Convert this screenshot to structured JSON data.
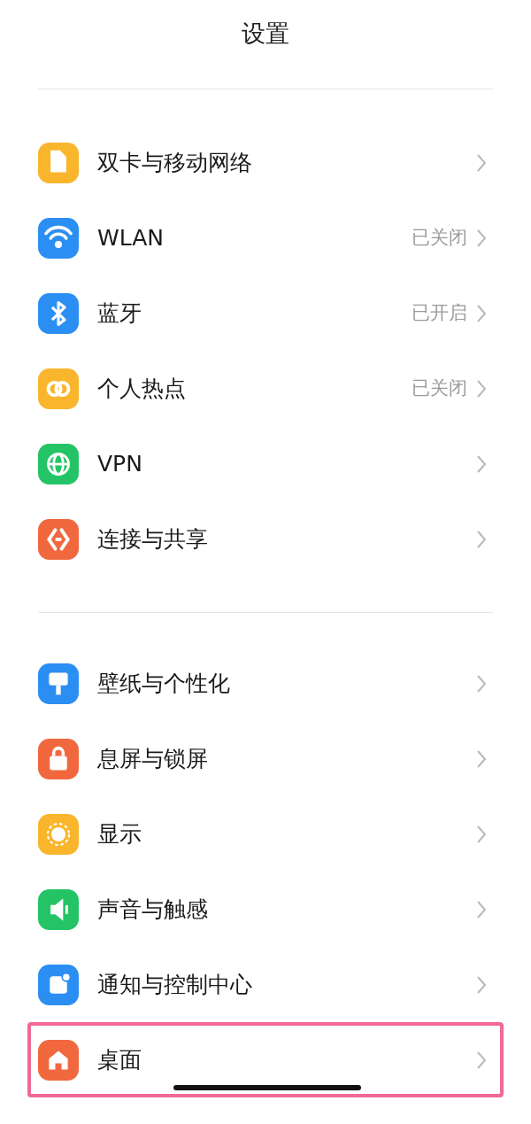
{
  "header": {
    "title": "设置"
  },
  "sections": [
    {
      "items": [
        {
          "label": "双卡与移动网络",
          "color": "#f9b52c",
          "highlighted": false
        },
        {
          "label": "WLAN",
          "status": "已关闭",
          "color": "#2b8ef3",
          "highlighted": false
        },
        {
          "label": "蓝牙",
          "status": "已开启",
          "color": "#2b8ef3",
          "highlighted": false
        },
        {
          "label": "个人热点",
          "status": "已关闭",
          "color": "#f9b52c",
          "highlighted": false
        },
        {
          "label": "VPN",
          "color": "#24c466",
          "highlighted": false
        },
        {
          "label": "连接与共享",
          "color": "#f1683f",
          "highlighted": false
        }
      ]
    },
    {
      "items": [
        {
          "label": "壁纸与个性化",
          "color": "#2b8ef3",
          "highlighted": false
        },
        {
          "label": "息屏与锁屏",
          "color": "#f1683f",
          "highlighted": false
        },
        {
          "label": "显示",
          "color": "#f9b52c",
          "highlighted": false
        },
        {
          "label": "声音与触感",
          "color": "#24c466",
          "highlighted": false
        },
        {
          "label": "通知与控制中心",
          "color": "#2b8ef3",
          "highlighted": false
        },
        {
          "label": "桌面",
          "color": "#f1683f",
          "highlighted": true
        }
      ]
    }
  ]
}
